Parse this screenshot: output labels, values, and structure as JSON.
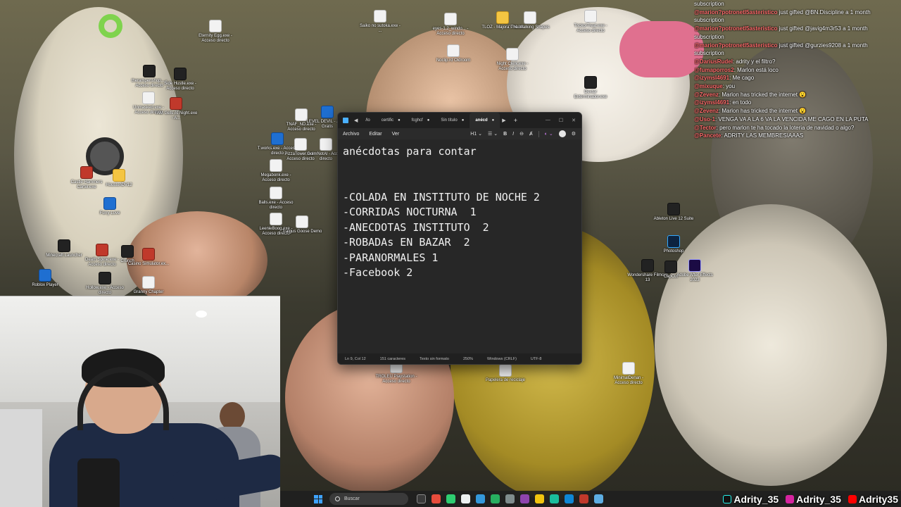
{
  "desktop_icons": [
    {
      "label": "Eternity Egg.exe - Acceso directo",
      "kind": "file"
    },
    {
      "label": "Saiko no sutoka.exe - ...",
      "kind": "file"
    },
    {
      "label": "eyes-1.2_windo... - Acceso directo",
      "kind": "file"
    },
    {
      "label": "TLOZ - Majora's Mask",
      "kind": "folder"
    },
    {
      "label": "The Walking Shapes",
      "kind": "file"
    },
    {
      "label": "TrickorTreat.exe - Acceso directo",
      "kind": "file"
    },
    {
      "label": "Night Clerk.exe - Acceso directo",
      "kind": "file"
    },
    {
      "label": "Noclip.rd Oldroom",
      "kind": "file"
    },
    {
      "label": "therampenshop... - Acceso directo",
      "kind": "dark"
    },
    {
      "label": "Side Hustle.exe - Acceso directo",
      "kind": "dark"
    },
    {
      "label": "Unmasked.exe - Acceso directo",
      "kind": "file"
    },
    {
      "label": "TAM Gets At Night.exe - A...",
      "kind": "red"
    },
    {
      "label": "TNAF_ND.exe - Acceso directo",
      "kind": "file"
    },
    {
      "label": "LEVEL DEVIL - Juega Gratis",
      "kind": "blue"
    },
    {
      "label": "Castle Hammers Cartel.exe",
      "kind": "red"
    },
    {
      "label": "HoustonDV12",
      "kind": "folder"
    },
    {
      "label": "T.works.exe - Acceso directo",
      "kind": "blue"
    },
    {
      "label": "PizzaTower.exe - Acceso directo",
      "kind": "file"
    },
    {
      "label": "GolmNotAl - Acceso directo",
      "kind": "file"
    },
    {
      "label": "Megabonk.exe - Acceso directo",
      "kind": "file"
    },
    {
      "label": "Balls.exe - Acceso directo",
      "kind": "file"
    },
    {
      "label": "Furry Love",
      "kind": "blue"
    },
    {
      "label": "LeenieBoog.exe - Acceso directo",
      "kind": "file"
    },
    {
      "label": "Tralgus Goose Demo",
      "kind": "file"
    },
    {
      "label": "Minecraft Launcher",
      "kind": "dark"
    },
    {
      "label": "Death Spine.exe - Acceso directo",
      "kind": "red"
    },
    {
      "label": "Crunch",
      "kind": "dark"
    },
    {
      "label": "Casino Simulator.ex...",
      "kind": "red"
    },
    {
      "label": "Roblox Player",
      "kind": "blue"
    },
    {
      "label": "Hollow.exe - Acceso directo",
      "kind": "dark"
    },
    {
      "label": "Granny Chapter",
      "kind": "file"
    },
    {
      "label": "Dexter Exterminador.exe",
      "kind": "dark"
    },
    {
      "label": "Ableton Live 12 Suite",
      "kind": "dark"
    },
    {
      "label": "Photoshop",
      "kind": "ps"
    },
    {
      "label": "Wondershare Filmora 13",
      "kind": "dark"
    },
    {
      "label": "CapCut",
      "kind": "dark"
    },
    {
      "label": "Adobe After Effects 2023",
      "kind": "ae"
    },
    {
      "label": "Papelera de reciclaje",
      "kind": "file"
    },
    {
      "label": "TROLEU Playstation - Acceso directo",
      "kind": "file"
    },
    {
      "label": "MinimalDenan - Acceso directo",
      "kind": "file"
    }
  ],
  "chat": [
    {
      "user": "",
      "text": "subscription"
    },
    {
      "user": "@marion?potronetl5asteristico",
      "text": " just gifted @BN.Discipline a 1 month"
    },
    {
      "user": "",
      "text": "subscription"
    },
    {
      "user": "@marion?potronetl5asteristico",
      "text": " just gifted @javig4m3r53 a 1 month"
    },
    {
      "user": "",
      "text": "subscription"
    },
    {
      "user": "@marion?potronetl5asteristico",
      "text": " just gifted @gurzies9208 a 1 month"
    },
    {
      "user": "",
      "text": "subscription"
    },
    {
      "user": "@DariusRudel",
      "text": ": adrity y el filtro?"
    },
    {
      "user": "@fumaporros2",
      "text": ": Marlon está loco"
    },
    {
      "user": "@izymsl4691",
      "text": ": Me cago"
    },
    {
      "user": "@mixuque",
      "text": ": you"
    },
    {
      "user": "@Zevenz",
      "text": ": Marlon has tricked the internet 😮"
    },
    {
      "user": "@izymsl4691",
      "text": ": en todo"
    },
    {
      "user": "@Zevenz",
      "text": ": Marlon has tricked the internet 😮"
    },
    {
      "user": "@Uso-1",
      "text": ": VENGA VA A LA 6 VA LA VENCIDA ME CAGO EN LA PUTA"
    },
    {
      "user": "@Tector",
      "text": ": pero marlon te ha tocado la loteria de navidad o algo?"
    },
    {
      "user": "@Pancete",
      "text": ": ADRITY LAS MEMBRESIAAAS"
    }
  ],
  "notepad": {
    "tabs": [
      {
        "label": "/lo"
      },
      {
        "label": "certific"
      },
      {
        "label": "fcghcf"
      },
      {
        "label": "Sin título"
      },
      {
        "label": "anécd",
        "active": true
      }
    ],
    "menu": [
      "Archivo",
      "Editar",
      "Ver"
    ],
    "heading_label": "H1",
    "bold": "B",
    "italic": "I",
    "content": "anécdotas para contar\n\n\n-COLADA EN INSTITUTO DE NOCHE 2\n-CORRIDAS NOCTURNA  1\n-ANECDOTAS INSTITUTO  2\n-ROBADAs EN BAZAR  2\n-PARANORMALES 1\n-Facebook 2",
    "status": {
      "position": "Ln 9, Col 12",
      "chars": "151 caracteres",
      "format": "Texto sin formato",
      "zoom": "250%",
      "line_ending": "Windows (CRLF)",
      "encoding": "UTF-8"
    }
  },
  "taskbar": {
    "search_placeholder": "Buscar",
    "apps": [
      "#d35400",
      "#e74c3c",
      "#2ecc71",
      "#ecf0f1",
      "#3498db",
      "#27ae60",
      "#7f8c8d",
      "#8e44ad",
      "#f1c40f",
      "#1abc9c",
      "#0e86d4",
      "#c0392b",
      "#5dade2"
    ]
  },
  "socials": [
    {
      "platform": "tiktok-icon",
      "handle": "Adrity_35",
      "color": "#111111"
    },
    {
      "platform": "instagram-icon",
      "handle": "Adrity_35",
      "color": "#d6249f"
    },
    {
      "platform": "youtube-icon",
      "handle": "Adrity35",
      "color": "#ff0000"
    }
  ]
}
